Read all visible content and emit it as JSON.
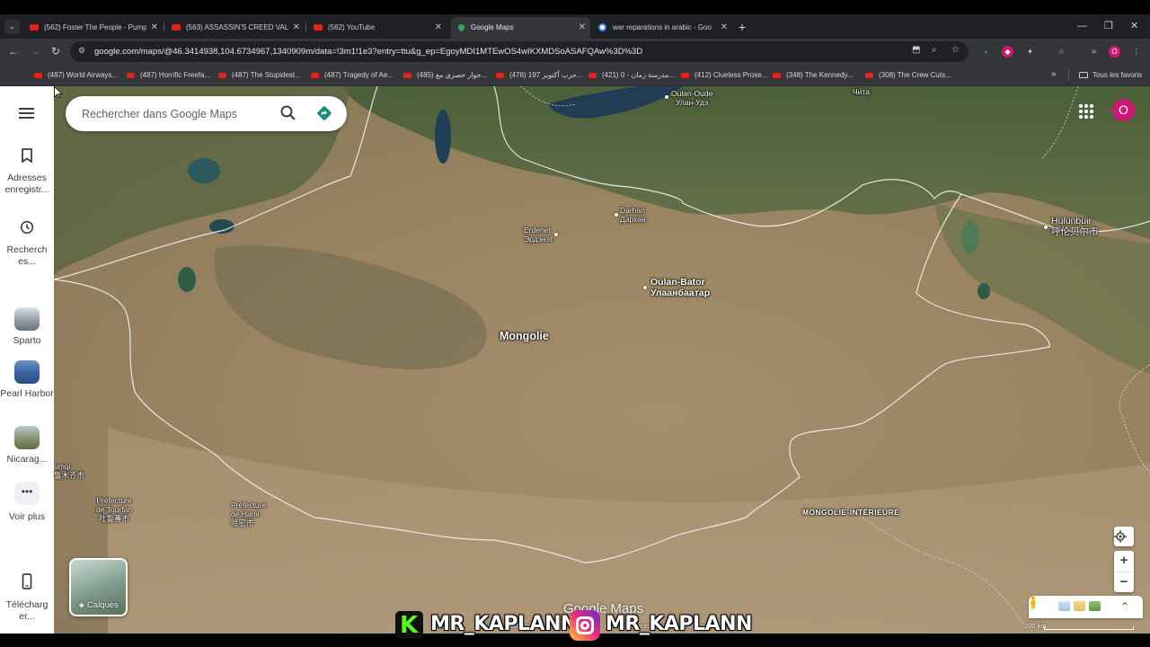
{
  "browser": {
    "tabs": [
      {
        "title": "(562) Foster The People - Pump",
        "icon": "youtube-icon"
      },
      {
        "title": "(563) ASSASSIN'S CREED VALHA",
        "icon": "youtube-icon"
      },
      {
        "title": "(562) YouTube",
        "icon": "youtube-icon"
      },
      {
        "title": "Google Maps",
        "icon": "maps-icon"
      },
      {
        "title": "war reparations in arabic - Goo",
        "icon": "google-icon"
      }
    ],
    "active_tab": 3,
    "url": "google.com/maps/@46.3414938,104.6734967,1340909m/data=!3m1!1e3?entry=ttu&g_ep=EgoyMDI1MTEwOS4wIKXMDSoASAFQAw%3D%3D",
    "profile_initial": "O",
    "bookmarks": [
      "(487) World Airways...",
      "(487) Horrific Freefa...",
      "(487) The Stupidest...",
      "(487) Tragedy of Ae...",
      "(485) جوار حصري مع...",
      "(476) حرب أكتوبر 197...",
      "(421) مدرسة زمان - 0...",
      "(412) Clueless Prose...",
      "(348) The Kennedy...",
      "(308) The Crew Cuts..."
    ],
    "all_bookmarks": "Tous les favoris"
  },
  "maps": {
    "search_placeholder": "Rechercher dans Google Maps",
    "rail": {
      "saved": "Adresses enregistr...",
      "recent": "Recherch es...",
      "items": [
        "Sparto",
        "Pearl Harbor",
        "Nicarag..."
      ],
      "more": "Voir plus",
      "download": "Télécharg er..."
    },
    "layers_label": "Calques",
    "account_initial": "O",
    "places": {
      "mongolia": "Mongolie",
      "ulaanbaatar_fr": "Oulan-Bator",
      "ulaanbaatar_mn": "Улаанбаатар",
      "ulanude_fr": "Oulan-Oude",
      "ulanude_ru": "Улан-Удэ",
      "chita": "Чита",
      "darhan_fr": "Darhan",
      "darhan_mn": "Дархан",
      "erdenet_fr": "Erdenet",
      "erdenet_mn": "Эрдэнэт",
      "hulunbuir_fr": "Hulunbuir",
      "hulunbuir_cn": "呼伦贝尔市",
      "inner_mongolia": "MONGOLIE-INTÉRIEURE",
      "urumqi_fr": "ümqi",
      "urumqi_cn": "鲁木齐市",
      "turfan_1": "Préfecture",
      "turfan_2": "de Tourfan",
      "turfan_cn": "吐鲁番市",
      "hami_1": "Préfecture",
      "hami_2": "de Hami",
      "hami_cn": "哈密市"
    },
    "watermark": "Google Maps",
    "footer": {
      "terms": "onditions d'utilisation",
      "privacy": "Confidentialité",
      "feedback": "Envoyer des commentaires sur le produit",
      "scale": "200 km"
    }
  },
  "overlay": {
    "handle_kick": "MR_KAPLANN",
    "handle_instagram": "MR_KAPLANN"
  }
}
